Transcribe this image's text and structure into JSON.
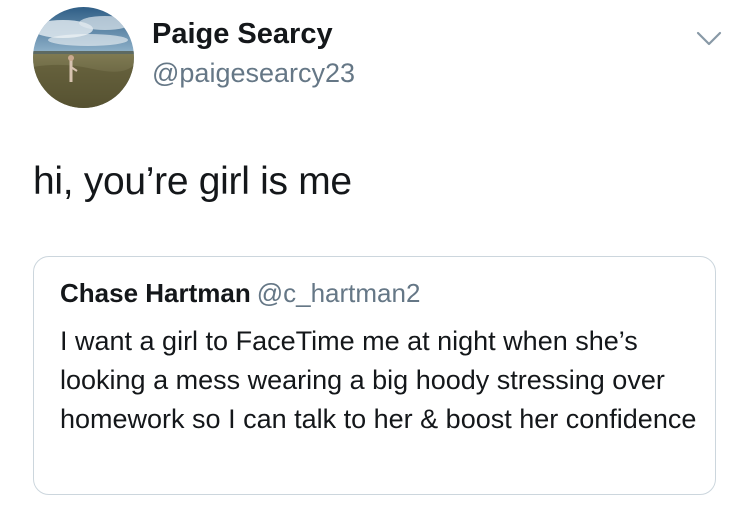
{
  "tweet": {
    "author": {
      "name": "Paige Searcy",
      "handle": "@paigesearcy23"
    },
    "text": "hi, you’re girl is me",
    "quoted_tweet": {
      "author_name": "Chase Hartman",
      "author_handle": "@c_hartman2",
      "text": "I want a girl to FaceTime me at night when she’s looking a mess wearing a big hoody stressing over homework so I can talk to her & boost her confidence"
    }
  },
  "icons": {
    "menu": "chevron-down-icon",
    "avatar": "avatar-photo"
  },
  "colors": {
    "primary_text": "#14171a",
    "secondary_text": "#657786",
    "border": "#ccd6dd",
    "background": "#ffffff"
  }
}
